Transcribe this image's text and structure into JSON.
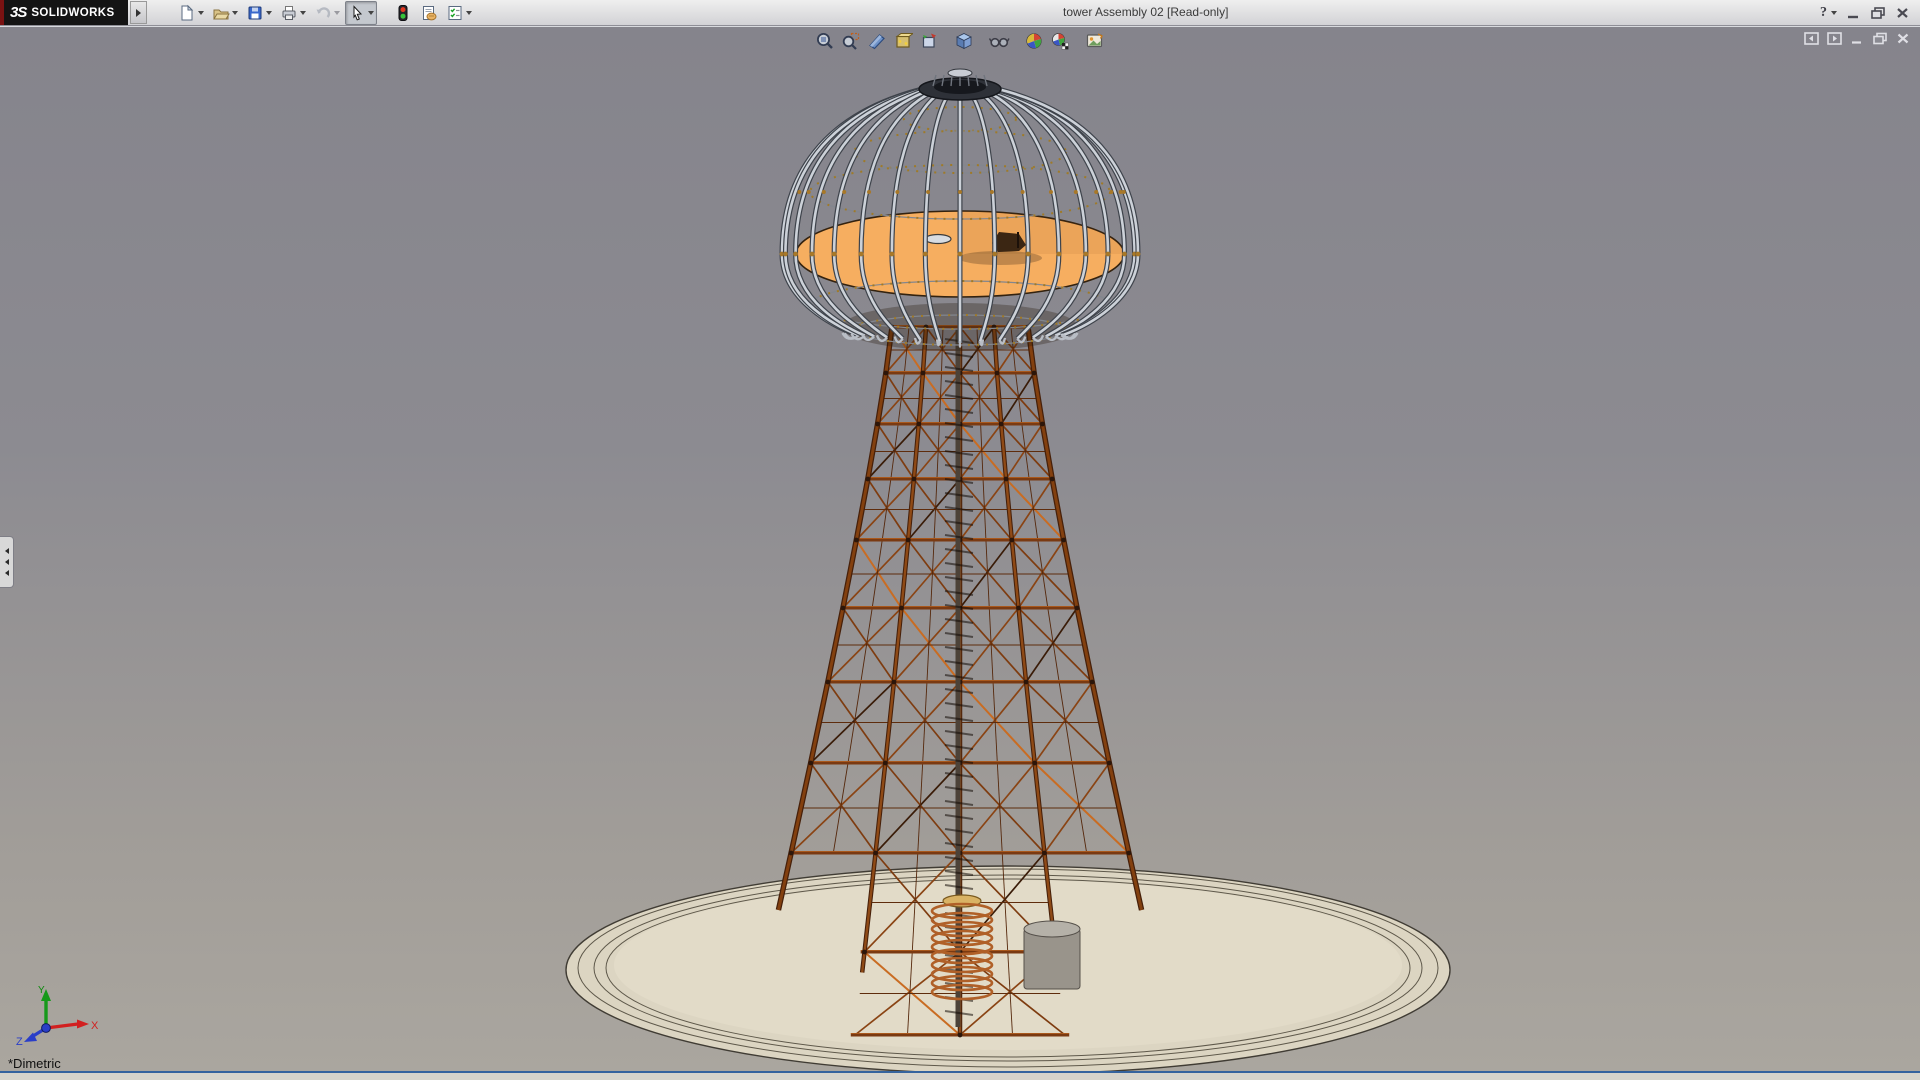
{
  "titlebar": {
    "logo_mark": "3S",
    "logo_text": "SOLIDWORKS",
    "title": "tower Assembly 02 [Read-only]",
    "help_label": "?"
  },
  "toolbar": {
    "buttons": [
      {
        "id": "new",
        "icon": "new-document-icon",
        "dropdown": true
      },
      {
        "id": "open",
        "icon": "open-icon",
        "dropdown": true
      },
      {
        "id": "save",
        "icon": "save-icon",
        "dropdown": true
      },
      {
        "id": "print",
        "icon": "print-icon",
        "dropdown": true
      },
      {
        "id": "undo",
        "icon": "undo-icon",
        "dropdown": true,
        "disabled": true
      },
      {
        "id": "select",
        "icon": "select-cursor-icon",
        "dropdown": true,
        "active": true
      },
      {
        "id": "rebuild",
        "icon": "rebuild-traffic-light-icon",
        "dropdown": false
      },
      {
        "id": "file-properties",
        "icon": "file-properties-icon",
        "dropdown": false
      },
      {
        "id": "options",
        "icon": "options-icon",
        "dropdown": true
      }
    ]
  },
  "headsup_toolbar": {
    "buttons": [
      "zoom-to-fit",
      "zoom-to-area",
      "section-view",
      "view-orientation",
      "display-style",
      "shaded-with-edges",
      "hide-show-items",
      "edit-appearance",
      "apply-scene",
      "view-settings"
    ]
  },
  "window_controls": [
    "help",
    "minimize",
    "restore",
    "close"
  ],
  "document_controls": [
    "previous-window",
    "next-window",
    "minimize-document",
    "restore-document",
    "close-document"
  ],
  "viewport": {
    "view_label": "*Dimetric",
    "triad": {
      "x_label": "X",
      "y_label": "Y",
      "z_label": "Z"
    }
  },
  "colors": {
    "viewport_gradient_top": "#85848c",
    "viewport_gradient_bottom": "#aaa69f",
    "dome_platform_orange": "#f6ae60",
    "tower_copper": "#7a3a12",
    "tower_highlight": "#d27a28",
    "cage_silver": "#ccd1d8",
    "base_pad_cream": "#ddd6c3",
    "logo_background": "#141414",
    "statusbar_accent": "#35639e"
  }
}
